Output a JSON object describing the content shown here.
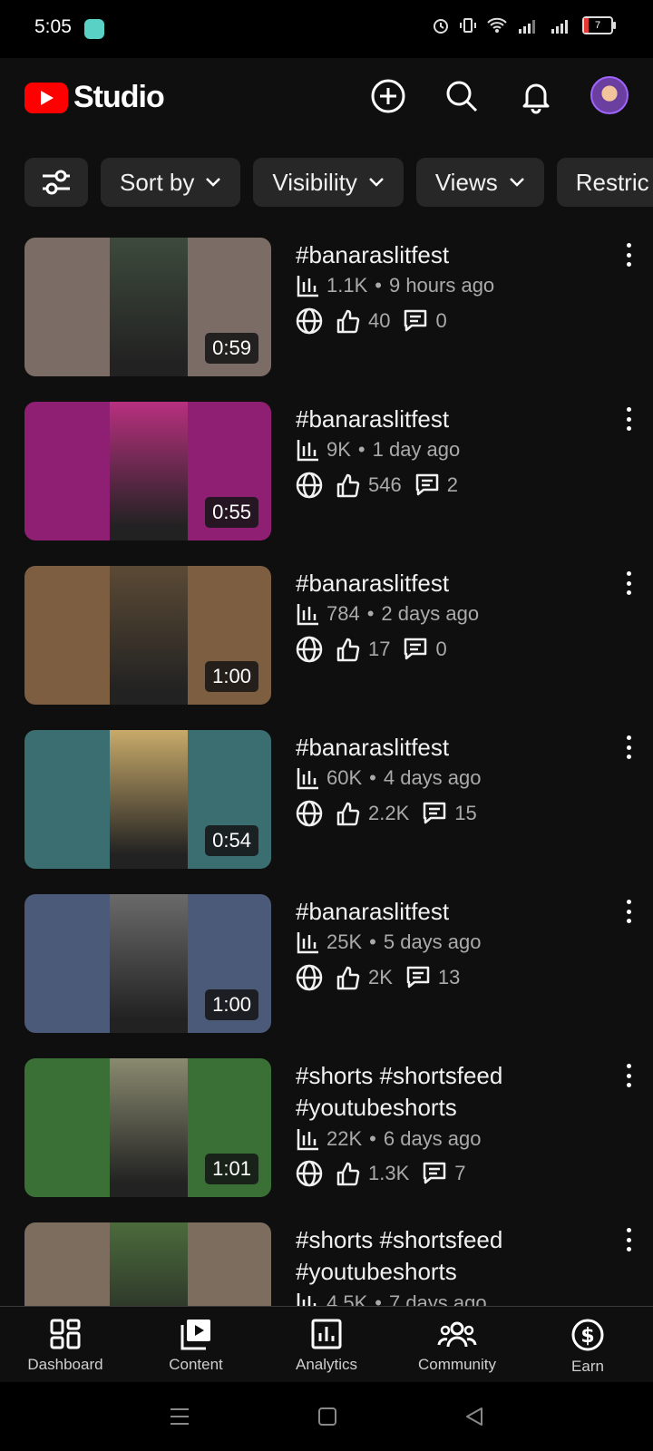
{
  "status_bar": {
    "time": "5:05",
    "battery": "7"
  },
  "header": {
    "app_name": "Studio"
  },
  "filters": [
    {
      "label": "Sort by"
    },
    {
      "label": "Visibility"
    },
    {
      "label": "Views"
    },
    {
      "label": "Restric"
    }
  ],
  "videos": [
    {
      "title": "#banaraslitfest",
      "views": "1.1K",
      "age": "9 hours ago",
      "likes": "40",
      "comments": "0",
      "duration": "0:59",
      "color": "#7c6c66",
      "center": "#3d4a3c"
    },
    {
      "title": "#banaraslitfest",
      "views": "9K",
      "age": "1 day ago",
      "likes": "546",
      "comments": "2",
      "duration": "0:55",
      "color": "#8f1f73",
      "center": "#b8307f"
    },
    {
      "title": "#banaraslitfest",
      "views": "784",
      "age": "2 days ago",
      "likes": "17",
      "comments": "0",
      "duration": "1:00",
      "color": "#7d5e40",
      "center": "#5b4a35"
    },
    {
      "title": "#banaraslitfest",
      "views": "60K",
      "age": "4 days ago",
      "likes": "2.2K",
      "comments": "15",
      "duration": "0:54",
      "color": "#3b6e70",
      "center": "#c8aa6a"
    },
    {
      "title": "#banaraslitfest",
      "views": "25K",
      "age": "5 days ago",
      "likes": "2K",
      "comments": "13",
      "duration": "1:00",
      "color": "#4b5a78",
      "center": "#6a6a6a"
    },
    {
      "title": "#shorts #shortsfeed #youtubeshorts",
      "views": "22K",
      "age": "6 days ago",
      "likes": "1.3K",
      "comments": "7",
      "duration": "1:01",
      "color": "#3a7036",
      "center": "#8a8a70"
    },
    {
      "title": "#shorts #shortsfeed #youtubeshorts",
      "views": "4.5K",
      "age": "7 days ago",
      "likes": "",
      "comments": "",
      "duration": "",
      "color": "#7d6d5f",
      "center": "#4b6b3c"
    }
  ],
  "bottom_nav": [
    {
      "label": "Dashboard",
      "icon": "dashboard-icon"
    },
    {
      "label": "Content",
      "icon": "content-icon"
    },
    {
      "label": "Analytics",
      "icon": "analytics-icon"
    },
    {
      "label": "Community",
      "icon": "community-icon"
    },
    {
      "label": "Earn",
      "icon": "earn-icon"
    }
  ]
}
